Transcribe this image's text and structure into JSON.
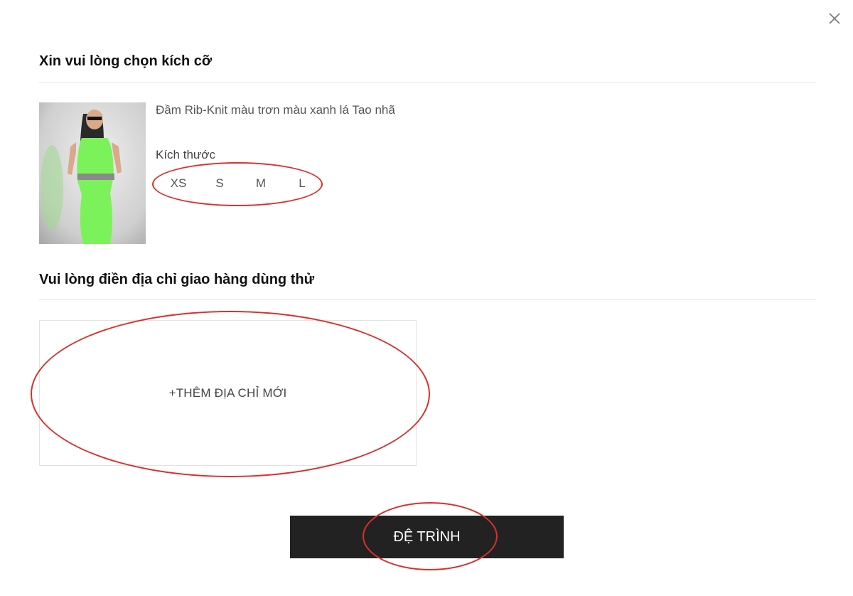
{
  "dialog": {
    "close_icon": "close-icon"
  },
  "size_section": {
    "title": "Xin vui lòng chọn kích cỡ",
    "product": {
      "name": "Đầm Rib-Knit màu trơn màu xanh lá Tao nhã",
      "size_label": "Kích thước",
      "sizes": [
        "XS",
        "S",
        "M",
        "L"
      ]
    }
  },
  "address_section": {
    "title": "Vui lòng điền địa chỉ giao hàng dùng thử",
    "add_address_label": "+THÊM ĐỊA CHỈ MỚI"
  },
  "submit": {
    "label": "ĐỆ TRÌNH"
  },
  "colors": {
    "annotation": "#d9302c",
    "button_bg": "#222222",
    "dress": "#7cf25a"
  }
}
